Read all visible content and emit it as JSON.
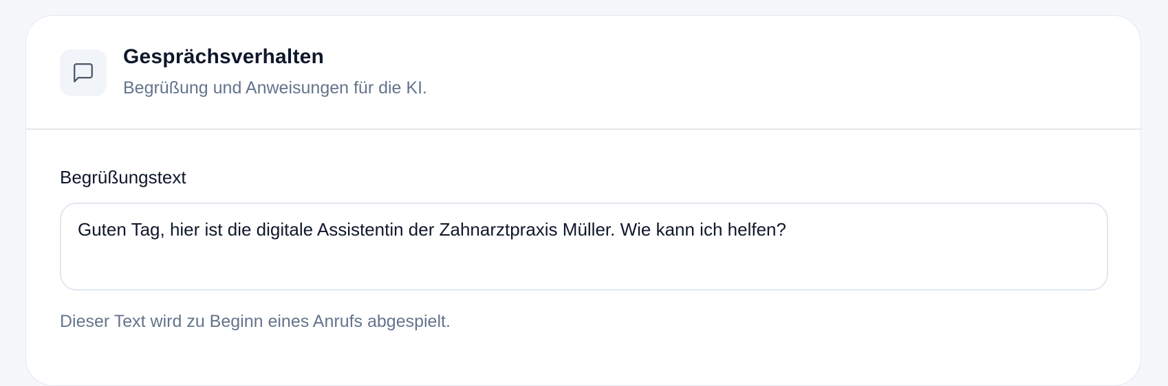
{
  "section": {
    "icon": "message-square-icon",
    "title": "Gesprächsverhalten",
    "subtitle": "Begrüßung und Anweisungen für die KI."
  },
  "greeting": {
    "label": "Begrüßungstext",
    "value": "Guten Tag, hier ist die digitale Assistentin der Zahnarztpraxis Müller. Wie kann ich helfen?",
    "hint": "Dieser Text wird zu Beginn eines Anrufs abgespielt."
  },
  "colors": {
    "page_background": "#f5f7fa",
    "card_background": "#ffffff",
    "title_text": "#0f172a",
    "muted_text": "#64748b",
    "border": "#e2e8f0",
    "icon_background": "#f1f5f9"
  }
}
